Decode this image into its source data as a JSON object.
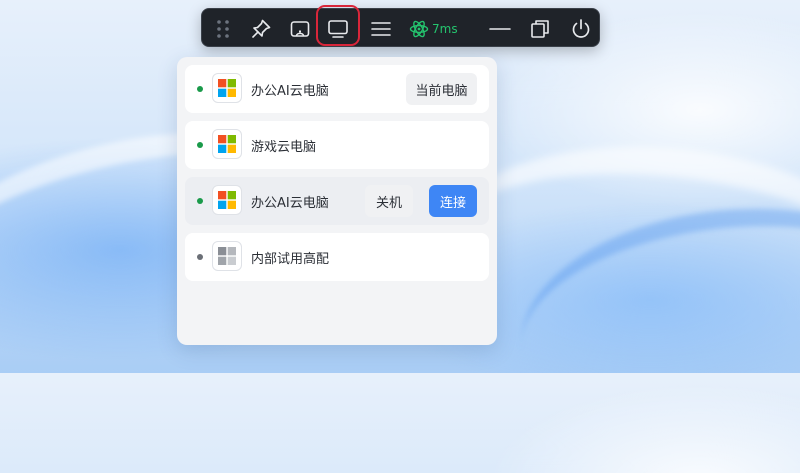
{
  "toolbar": {
    "ping": "7ms",
    "icons": [
      "drag-handle-icon",
      "pin-icon",
      "screen-cast-icon",
      "monitor-icon",
      "menu-icon",
      "network-atom-icon",
      "minimize-icon",
      "restore-icon",
      "power-icon"
    ],
    "ping_color": "#24c46e",
    "highlight_color": "#d9263a"
  },
  "computers": {
    "items": [
      {
        "name": "办公AI云电脑",
        "status": "online",
        "action": "当前电脑"
      },
      {
        "name": "游戏云电脑",
        "status": "online"
      },
      {
        "name": "办公AI云电脑",
        "status": "online",
        "actions": [
          "关机",
          "连接"
        ]
      },
      {
        "name": "内部试用高配",
        "status": "offline"
      }
    ],
    "status_colors": {
      "online": "#1a9a4a",
      "offline": "#6b6f76"
    },
    "accent": "#3e86f5"
  }
}
